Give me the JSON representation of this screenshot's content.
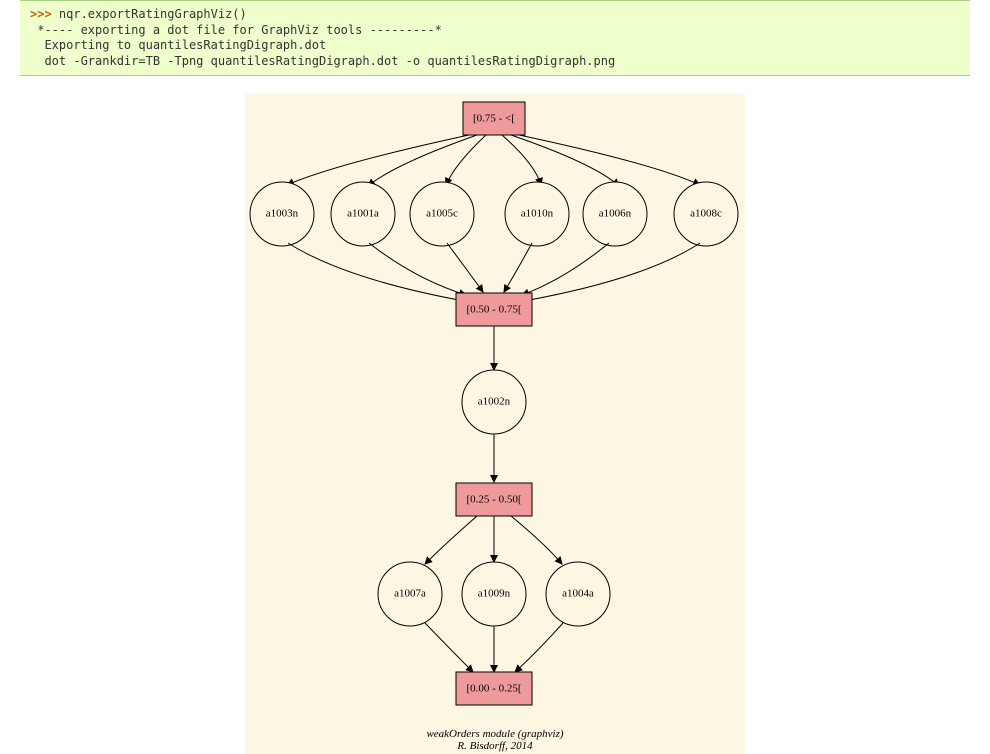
{
  "code": {
    "prompt": ">>> ",
    "command": "nqr.exportRatingGraphViz()",
    "out_line1": "*---- exporting a dot file for GraphViz tools ---------*",
    "out_line2": "Exporting to quantilesRatingDigraph.dot",
    "out_line3": "dot -Grankdir=TB -Tpng quantilesRatingDigraph.dot -o quantilesRatingDigraph.png"
  },
  "graph": {
    "quantiles": {
      "q0": "[0.75 - <[",
      "q1": "[0.50 - 0.75[",
      "q2": "[0.25 - 0.50[",
      "q3": "[0.00 - 0.25["
    },
    "row1": {
      "n0": "a1003n",
      "n1": "a1001a",
      "n2": "a1005c",
      "n3": "a1010n",
      "n4": "a1006n",
      "n5": "a1008c"
    },
    "mid": {
      "n0": "a1002n"
    },
    "row3": {
      "n0": "a1007a",
      "n1": "a1009n",
      "n2": "a1004a"
    },
    "caption1": "weakOrders module (graphviz)",
    "caption2": "R. Bisdorff, 2014"
  }
}
